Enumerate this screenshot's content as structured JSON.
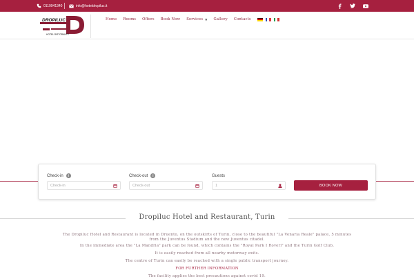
{
  "topbar": {
    "phone": "0119941340",
    "email": "info@hoteldropiluc.it",
    "social": [
      "facebook-icon",
      "twitter-icon",
      "youtube-icon"
    ]
  },
  "logo": {
    "text": "DROPILUC",
    "letter": "D",
    "subtitle": "HOTEL RISTORANTE"
  },
  "nav": {
    "items": [
      "Home",
      "Rooms",
      "Offers",
      "Book Now",
      "Services",
      "Gallery",
      "Contacts"
    ],
    "flags": [
      "de",
      "fr",
      "it"
    ]
  },
  "booking": {
    "checkin_label": "Check-in",
    "checkin_placeholder": "Check-in",
    "checkout_label": "Check-out",
    "checkout_placeholder": "Check-out",
    "guests_label": "Guests",
    "guests_value": "1",
    "button": "BOOK NOW"
  },
  "content": {
    "title": "Dropiluc Hotel and Restaurant, Turin",
    "p1_line1": "The Dropiluc Hotel and Restaurant is located in Druento, on the outskirts of Turin, close to the beautiful \"La Venaria Reale\" palace, 5 minutes",
    "p1_line2": "from the Juventus Stadium and the new Juventus citadel.",
    "p2": "In the immediate area the \"La Mandria\" park can be found, which contains the \"Royal Park I Roveri\" and the Turin Golf Club.",
    "p3": "It is easily reached from all nearby motorway exits.",
    "p4": "The centre of Turin can easily be reached with a single public transport journey.",
    "link": "FOR FURTHER INFORMATION",
    "p5": "The facility applies the best precautions against covid 19."
  },
  "colors": {
    "brand": "#a6203f"
  }
}
